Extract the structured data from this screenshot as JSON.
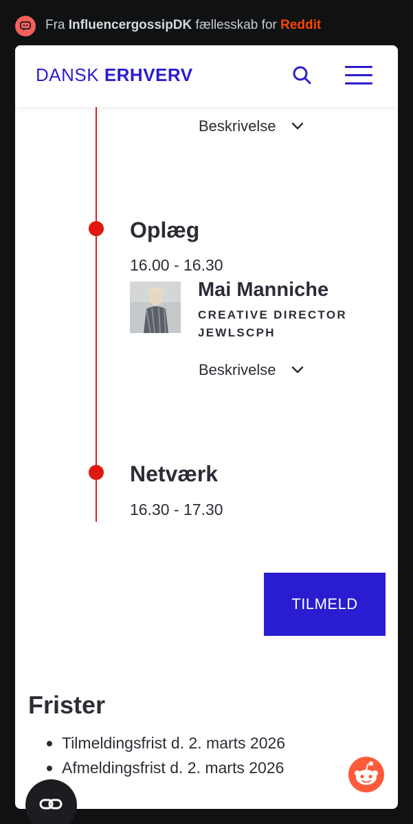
{
  "reddit_banner": {
    "prefix": "Fra",
    "community": "InfluencergossipDK",
    "middle": "fællesskab for",
    "platform": "Reddit"
  },
  "header": {
    "logo_light": "DANSK",
    "logo_bold": "ERHVERV",
    "brand_color": "#2a1cd0"
  },
  "timeline": {
    "accent_color": "#e0180f",
    "description_label_top": "Beskrivelse",
    "sessions": [
      {
        "title": "Oplæg",
        "time": "16.00 - 16.30",
        "speaker": {
          "name": "Mai Manniche",
          "role": "CREATIVE DIRECTOR JEWLSCPH"
        },
        "description_label": "Beskrivelse"
      },
      {
        "title": "Netværk",
        "time": "16.30 - 17.30"
      }
    ]
  },
  "cta": {
    "label": "TILMELD"
  },
  "frister": {
    "title": "Frister",
    "items": [
      "Tilmeldingsfrist d. 2. marts 2026",
      "Afmeldingsfrist d. 2. marts 2026"
    ]
  },
  "icons": {
    "search": "search-icon",
    "menu": "hamburger-menu-icon",
    "chevron": "chevron-down-icon",
    "reddit": "reddit-snoo-icon",
    "fab": "link-icon"
  }
}
